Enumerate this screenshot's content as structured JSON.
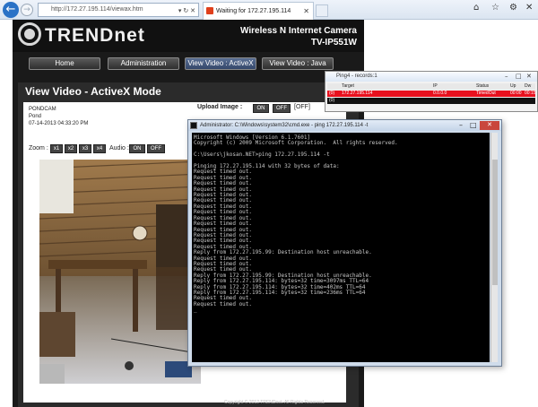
{
  "browser": {
    "url": "http://172.27.195.114/viewax.htm",
    "tab_title": "Waiting for 172.27.195.114",
    "addr_controls": "▾ ↻ ✕"
  },
  "header": {
    "brand": "TRENDnet",
    "product_title": "Wireless N Internet Camera",
    "model": "TV-IP551W"
  },
  "nav": {
    "items": [
      "Home",
      "Administration",
      "View Video : ActiveX",
      "View Video : Java"
    ]
  },
  "view": {
    "title": "View Video - ActiveX Mode",
    "camera_name": "PONDCAM",
    "location": "Pond",
    "timestamp": "07-14-2013 04:33:20 PM",
    "upload_label": "Upload Image :",
    "on_label": "ON",
    "off_label": "OFF",
    "upload_state": "[OFF]",
    "zoom_label": "Zoom :",
    "zoom_options": [
      "x1",
      "x2",
      "x3",
      "x4"
    ],
    "audio_label": "Audio :",
    "audio_on": "ON",
    "audio_off": "OFF",
    "copyright": "Copyright © 2012 TRENDnet. All Rights Reserved."
  },
  "ping_window": {
    "title": "Ping4 - records:1",
    "columns": [
      "Target",
      "IP",
      "Status",
      "Up",
      "Dw"
    ],
    "row": {
      "index": "(0)",
      "target": "172.27.195.114",
      "ip": "0.0.0.0",
      "status": "TimedOut",
      "up": "00:00",
      "dw": "00:15"
    },
    "row2": {
      "index": "(0)"
    }
  },
  "cmd_window": {
    "title": "Administrator: C:\\Windows\\system32\\cmd.exe - ping 172.27.195.114 -t",
    "lines": [
      "Microsoft Windows [Version 6.1.7601]",
      "Copyright (c) 2009 Microsoft Corporation.  All rights reserved.",
      "",
      "C:\\Users\\jkosan.NET>ping 172.27.195.114 -t",
      "",
      "Pinging 172.27.195.114 with 32 bytes of data:",
      "Request timed out.",
      "Request timed out.",
      "Request timed out.",
      "Request timed out.",
      "Request timed out.",
      "Request timed out.",
      "Request timed out.",
      "Request timed out.",
      "Request timed out.",
      "Request timed out.",
      "Request timed out.",
      "Request timed out.",
      "Request timed out.",
      "Request timed out.",
      "Reply from 172.27.195.99: Destination host unreachable.",
      "Request timed out.",
      "Request timed out.",
      "Request timed out.",
      "Reply from 172.27.195.99: Destination host unreachable.",
      "Reply from 172.27.195.114: bytes=32 time=3097ms TTL=64",
      "Reply from 172.27.195.114: bytes=32 time=402ms TTL=64",
      "Reply from 172.27.195.114: bytes=32 time=236ms TTL=64",
      "Request timed out.",
      "Request timed out.",
      "_"
    ]
  },
  "colors": {
    "ping_alert": "#e8101e",
    "console_bg": "#000000",
    "nav_active": "#34476a"
  }
}
